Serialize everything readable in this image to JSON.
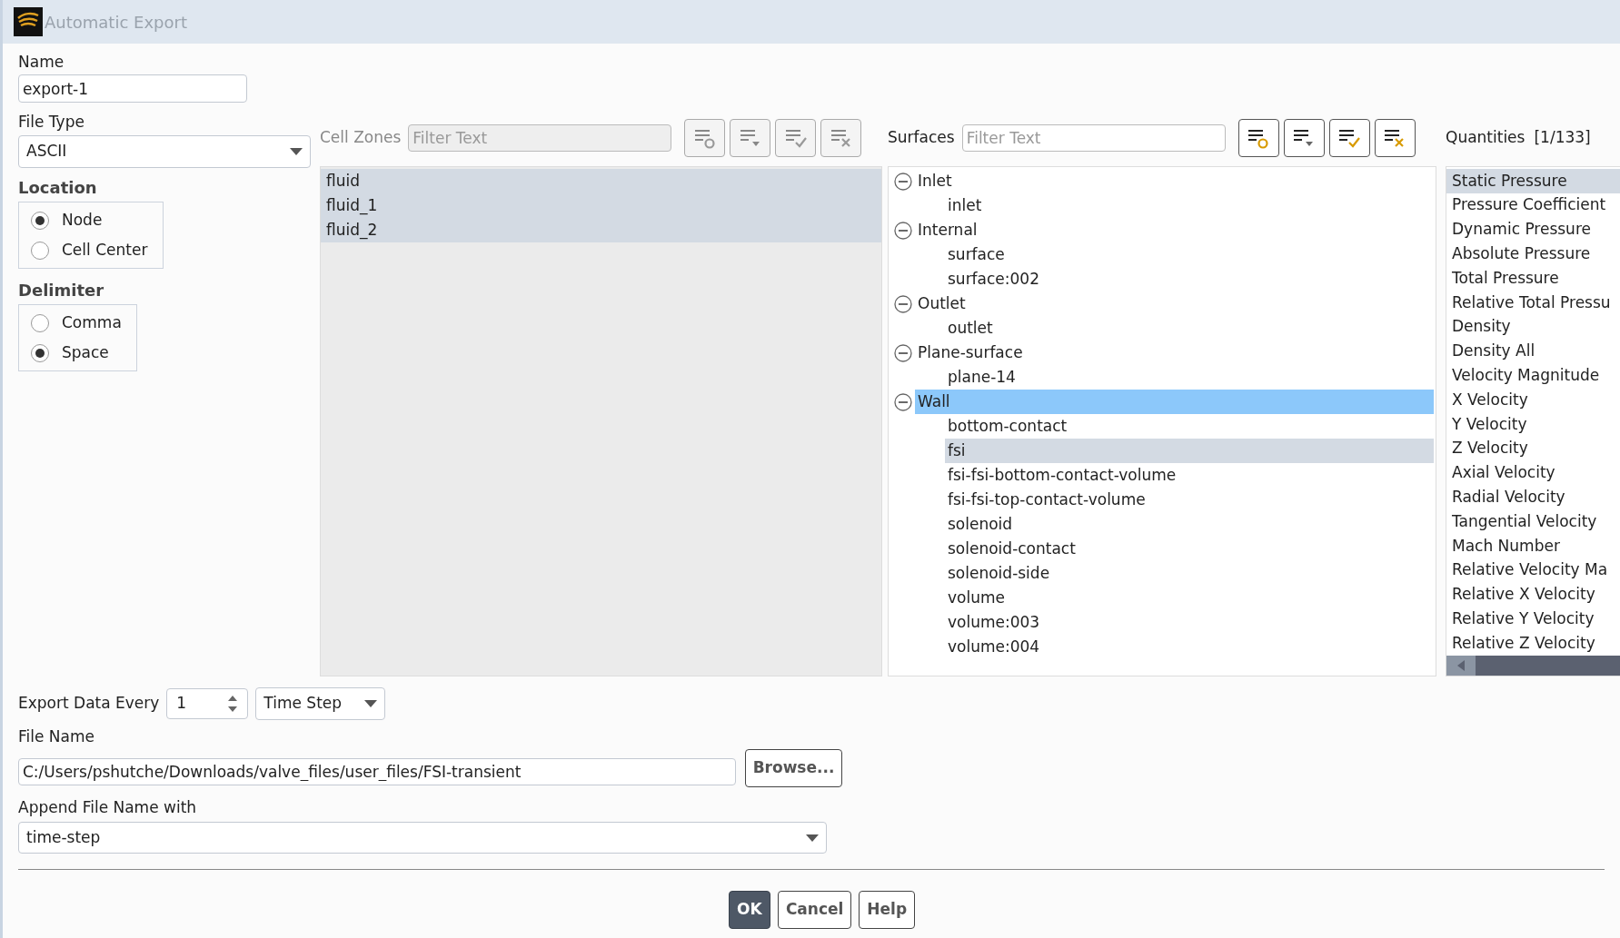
{
  "window": {
    "title": "Automatic Export"
  },
  "name": {
    "label": "Name",
    "value": "export-1"
  },
  "file_type": {
    "label": "File Type",
    "value": "ASCII"
  },
  "location": {
    "label": "Location",
    "options": [
      {
        "label": "Node",
        "selected": true
      },
      {
        "label": "Cell Center",
        "selected": false
      }
    ]
  },
  "delimiter": {
    "label": "Delimiter",
    "options": [
      {
        "label": "Comma",
        "selected": false
      },
      {
        "label": "Space",
        "selected": true
      }
    ]
  },
  "cell_zones": {
    "label": "Cell Zones",
    "filter_placeholder": "Filter Text",
    "toolbar": [
      {
        "kind": "filter",
        "disabled": true
      },
      {
        "kind": "sort",
        "disabled": true
      },
      {
        "kind": "select-all",
        "disabled": true
      },
      {
        "kind": "deselect-all",
        "disabled": true
      }
    ],
    "items": [
      {
        "label": "fluid",
        "selected": true
      },
      {
        "label": "fluid_1",
        "selected": true
      },
      {
        "label": "fluid_2",
        "selected": true
      }
    ]
  },
  "surfaces": {
    "label": "Surfaces",
    "filter_placeholder": "Filter Text",
    "toolbar": [
      {
        "kind": "filter",
        "disabled": false
      },
      {
        "kind": "sort",
        "disabled": false
      },
      {
        "kind": "select-all",
        "disabled": false
      },
      {
        "kind": "deselect-all",
        "disabled": false
      }
    ],
    "tree": [
      {
        "label": "Inlet",
        "expanded": true,
        "selected": false,
        "children": [
          {
            "label": "inlet",
            "selected": false
          }
        ]
      },
      {
        "label": "Internal",
        "expanded": true,
        "selected": false,
        "children": [
          {
            "label": "surface",
            "selected": false
          },
          {
            "label": "surface:002",
            "selected": false
          }
        ]
      },
      {
        "label": "Outlet",
        "expanded": true,
        "selected": false,
        "children": [
          {
            "label": "outlet",
            "selected": false
          }
        ]
      },
      {
        "label": "Plane-surface",
        "expanded": true,
        "selected": false,
        "children": [
          {
            "label": "plane-14",
            "selected": false
          }
        ]
      },
      {
        "label": "Wall",
        "expanded": true,
        "selected": true,
        "children": [
          {
            "label": "bottom-contact",
            "selected": false
          },
          {
            "label": "fsi",
            "selected": true
          },
          {
            "label": "fsi-fsi-bottom-contact-volume",
            "selected": false
          },
          {
            "label": "fsi-fsi-top-contact-volume",
            "selected": false
          },
          {
            "label": "solenoid",
            "selected": false
          },
          {
            "label": "solenoid-contact",
            "selected": false
          },
          {
            "label": "solenoid-side",
            "selected": false
          },
          {
            "label": "volume",
            "selected": false
          },
          {
            "label": "volume:003",
            "selected": false
          },
          {
            "label": "volume:004",
            "selected": false
          }
        ]
      }
    ]
  },
  "quantities": {
    "label": "Quantities",
    "count": "[1/133]",
    "items": [
      {
        "label": "Static Pressure",
        "selected": true
      },
      {
        "label": "Pressure Coefficient",
        "selected": false
      },
      {
        "label": "Dynamic Pressure",
        "selected": false
      },
      {
        "label": "Absolute Pressure",
        "selected": false
      },
      {
        "label": "Total Pressure",
        "selected": false
      },
      {
        "label": "Relative Total Pressu",
        "selected": false
      },
      {
        "label": "Density",
        "selected": false
      },
      {
        "label": "Density All",
        "selected": false
      },
      {
        "label": "Velocity Magnitude",
        "selected": false
      },
      {
        "label": "X Velocity",
        "selected": false
      },
      {
        "label": "Y Velocity",
        "selected": false
      },
      {
        "label": "Z Velocity",
        "selected": false
      },
      {
        "label": "Axial Velocity",
        "selected": false
      },
      {
        "label": "Radial Velocity",
        "selected": false
      },
      {
        "label": "Tangential Velocity",
        "selected": false
      },
      {
        "label": "Mach Number",
        "selected": false
      },
      {
        "label": "Relative Velocity Ma",
        "selected": false
      },
      {
        "label": "Relative X Velocity",
        "selected": false
      },
      {
        "label": "Relative Y Velocity",
        "selected": false
      },
      {
        "label": "Relative Z Velocity",
        "selected": false
      }
    ]
  },
  "export_every": {
    "label": "Export Data Every",
    "value": "1",
    "unit": "Time Step"
  },
  "file_name": {
    "label": "File Name",
    "value": "C:/Users/pshutche/Downloads/valve_files/user_files/FSI-transient",
    "browse": "Browse..."
  },
  "append": {
    "label": "Append File Name with",
    "value": "time-step"
  },
  "buttons": [
    {
      "label": "OK",
      "default": true
    },
    {
      "label": "Cancel",
      "default": false
    },
    {
      "label": "Help",
      "default": false
    }
  ]
}
